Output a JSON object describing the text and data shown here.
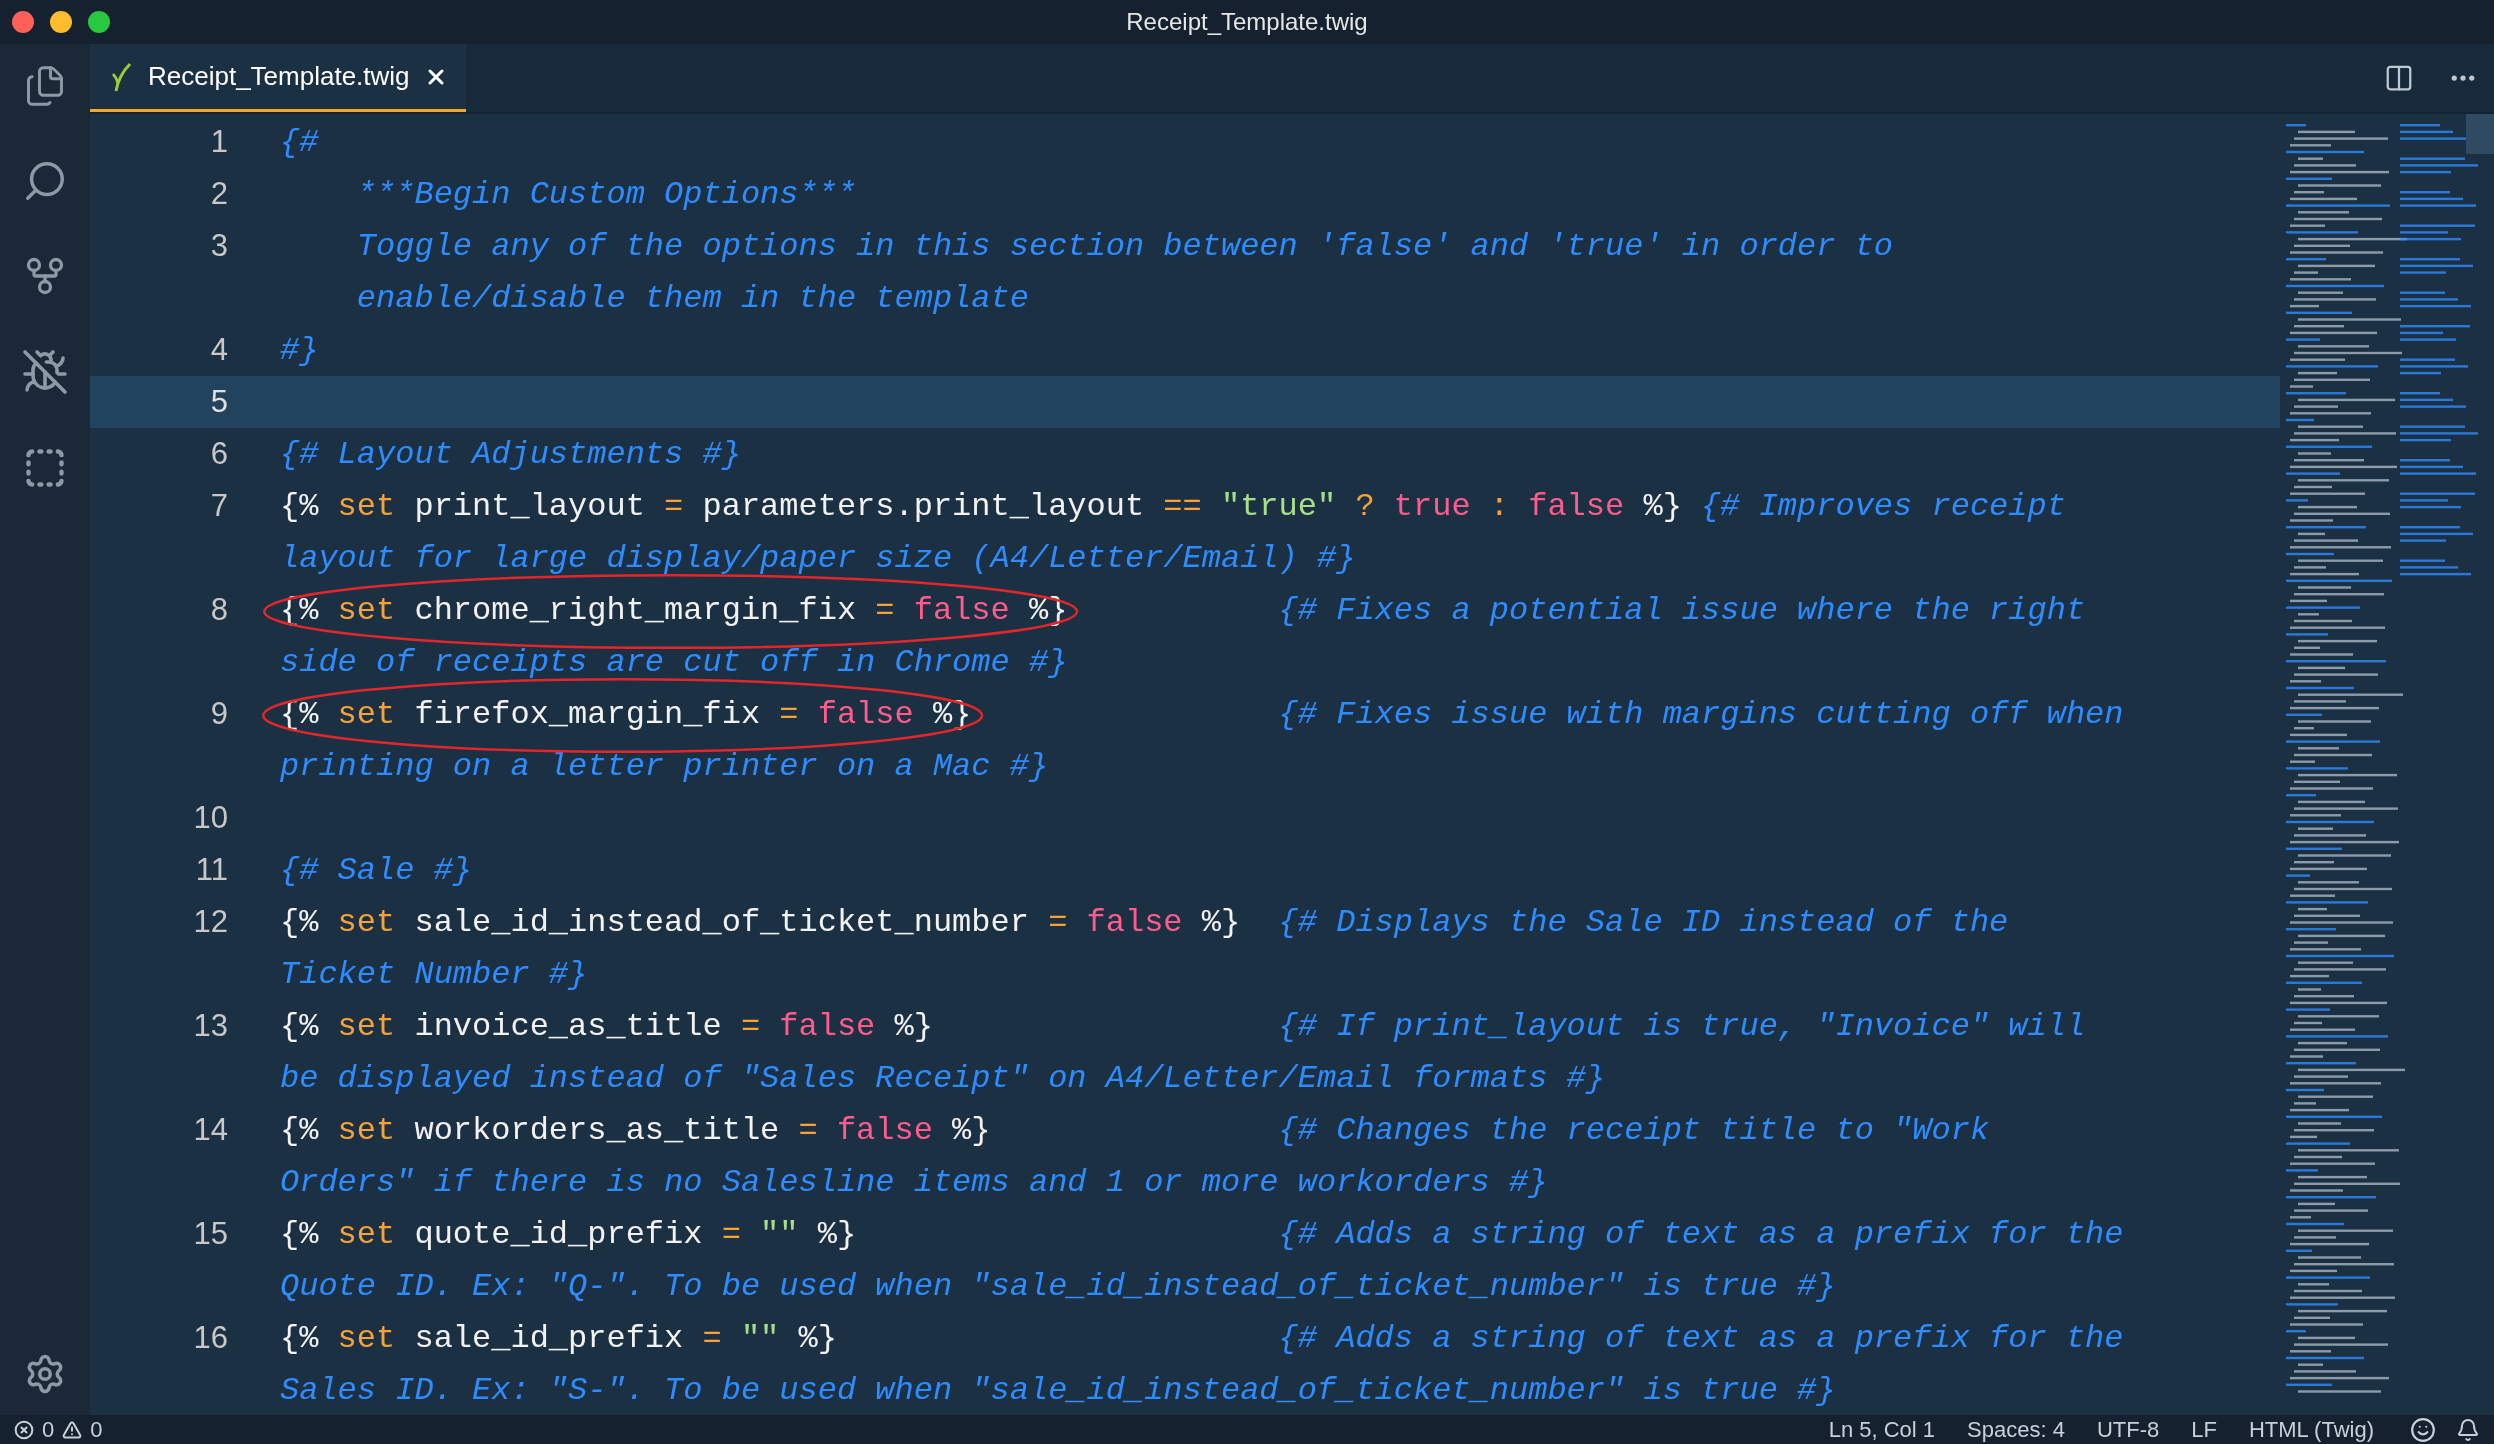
{
  "window": {
    "title": "Receipt_Template.twig"
  },
  "tabs": [
    {
      "label": "Receipt_Template.twig",
      "selected": true
    }
  ],
  "editor": {
    "lines": [
      {
        "number": "1",
        "current": false,
        "circled": false,
        "rows": [
          [
            {
              "text": "{#",
              "kind": "comment"
            }
          ]
        ]
      },
      {
        "number": "2",
        "current": false,
        "circled": false,
        "rows": [
          [
            {
              "text": "    ",
              "kind": "space"
            },
            {
              "text": "***Begin Custom Options***",
              "kind": "comment"
            }
          ]
        ]
      },
      {
        "number": "3",
        "current": false,
        "circled": false,
        "rows": [
          [
            {
              "text": "    ",
              "kind": "space"
            },
            {
              "text": "Toggle any of the options in this section between 'false' and 'true' in order to",
              "kind": "comment"
            }
          ],
          [
            {
              "text": "    ",
              "kind": "space"
            },
            {
              "text": "enable/disable them in the template",
              "kind": "comment"
            }
          ]
        ]
      },
      {
        "number": "4",
        "current": false,
        "circled": false,
        "rows": [
          [
            {
              "text": "#}",
              "kind": "comment"
            }
          ]
        ]
      },
      {
        "number": "5",
        "current": true,
        "circled": false,
        "rows": [
          []
        ]
      },
      {
        "number": "6",
        "current": false,
        "circled": false,
        "rows": [
          [
            {
              "text": "{# Layout Adjustments #}",
              "kind": "comment"
            }
          ]
        ]
      },
      {
        "number": "7",
        "current": false,
        "circled": false,
        "rows": [
          [
            {
              "text": "{% ",
              "kind": "punct"
            },
            {
              "text": "set",
              "kind": "keyword"
            },
            {
              "text": " print_layout ",
              "kind": "ident"
            },
            {
              "text": "=",
              "kind": "op"
            },
            {
              "text": " parameters.print_layout ",
              "kind": "ident"
            },
            {
              "text": "==",
              "kind": "op"
            },
            {
              "text": " ",
              "kind": "space"
            },
            {
              "text": "\"true\"",
              "kind": "string"
            },
            {
              "text": " ",
              "kind": "space"
            },
            {
              "text": "?",
              "kind": "op"
            },
            {
              "text": " ",
              "kind": "space"
            },
            {
              "text": "true",
              "kind": "bool"
            },
            {
              "text": " ",
              "kind": "space"
            },
            {
              "text": ":",
              "kind": "op"
            },
            {
              "text": " ",
              "kind": "space"
            },
            {
              "text": "false",
              "kind": "bool"
            },
            {
              "text": " %}",
              "kind": "punct"
            },
            {
              "text": " ",
              "kind": "space"
            },
            {
              "text": "{# Improves receipt",
              "kind": "comment"
            }
          ],
          [
            {
              "text": "layout for large display/paper size (A4/Letter/Email) #}",
              "kind": "comment"
            }
          ]
        ]
      },
      {
        "number": "8",
        "current": false,
        "circled": true,
        "rows": [
          [
            {
              "text": "{% ",
              "kind": "punct"
            },
            {
              "text": "set",
              "kind": "keyword"
            },
            {
              "text": " chrome_right_margin_fix ",
              "kind": "ident"
            },
            {
              "text": "=",
              "kind": "op"
            },
            {
              "text": " ",
              "kind": "space"
            },
            {
              "text": "false",
              "kind": "bool"
            },
            {
              "text": " %}",
              "kind": "punct"
            },
            {
              "text": "           ",
              "kind": "space"
            },
            {
              "text": "{# Fixes a potential issue where the right",
              "kind": "comment"
            }
          ],
          [
            {
              "text": "side of receipts are cut off in Chrome #}",
              "kind": "comment"
            }
          ]
        ]
      },
      {
        "number": "9",
        "current": false,
        "circled": true,
        "rows": [
          [
            {
              "text": "{% ",
              "kind": "punct"
            },
            {
              "text": "set",
              "kind": "keyword"
            },
            {
              "text": " firefox_margin_fix ",
              "kind": "ident"
            },
            {
              "text": "=",
              "kind": "op"
            },
            {
              "text": " ",
              "kind": "space"
            },
            {
              "text": "false",
              "kind": "bool"
            },
            {
              "text": " %}",
              "kind": "punct"
            },
            {
              "text": "                ",
              "kind": "space"
            },
            {
              "text": "{# Fixes issue with margins cutting off when",
              "kind": "comment"
            }
          ],
          [
            {
              "text": "printing on a letter printer on a Mac #}",
              "kind": "comment"
            }
          ]
        ]
      },
      {
        "number": "10",
        "current": false,
        "circled": false,
        "rows": [
          []
        ]
      },
      {
        "number": "11",
        "current": false,
        "circled": false,
        "rows": [
          [
            {
              "text": "{# Sale #}",
              "kind": "comment"
            }
          ]
        ]
      },
      {
        "number": "12",
        "current": false,
        "circled": false,
        "rows": [
          [
            {
              "text": "{% ",
              "kind": "punct"
            },
            {
              "text": "set",
              "kind": "keyword"
            },
            {
              "text": " sale_id_instead_of_ticket_number ",
              "kind": "ident"
            },
            {
              "text": "=",
              "kind": "op"
            },
            {
              "text": " ",
              "kind": "space"
            },
            {
              "text": "false",
              "kind": "bool"
            },
            {
              "text": " %}",
              "kind": "punct"
            },
            {
              "text": "  ",
              "kind": "space"
            },
            {
              "text": "{# Displays the Sale ID instead of the",
              "kind": "comment"
            }
          ],
          [
            {
              "text": "Ticket Number #}",
              "kind": "comment"
            }
          ]
        ]
      },
      {
        "number": "13",
        "current": false,
        "circled": false,
        "rows": [
          [
            {
              "text": "{% ",
              "kind": "punct"
            },
            {
              "text": "set",
              "kind": "keyword"
            },
            {
              "text": " invoice_as_title ",
              "kind": "ident"
            },
            {
              "text": "=",
              "kind": "op"
            },
            {
              "text": " ",
              "kind": "space"
            },
            {
              "text": "false",
              "kind": "bool"
            },
            {
              "text": " %}",
              "kind": "punct"
            },
            {
              "text": "                  ",
              "kind": "space"
            },
            {
              "text": "{# If print_layout is true, \"Invoice\" will",
              "kind": "comment"
            }
          ],
          [
            {
              "text": "be displayed instead of \"Sales Receipt\" on A4/Letter/Email formats #}",
              "kind": "comment"
            }
          ]
        ]
      },
      {
        "number": "14",
        "current": false,
        "circled": false,
        "rows": [
          [
            {
              "text": "{% ",
              "kind": "punct"
            },
            {
              "text": "set",
              "kind": "keyword"
            },
            {
              "text": " workorders_as_title ",
              "kind": "ident"
            },
            {
              "text": "=",
              "kind": "op"
            },
            {
              "text": " ",
              "kind": "space"
            },
            {
              "text": "false",
              "kind": "bool"
            },
            {
              "text": " %}",
              "kind": "punct"
            },
            {
              "text": "               ",
              "kind": "space"
            },
            {
              "text": "{# Changes the receipt title to \"Work",
              "kind": "comment"
            }
          ],
          [
            {
              "text": "Orders\" if there is no Salesline items and 1 or more workorders #}",
              "kind": "comment"
            }
          ]
        ]
      },
      {
        "number": "15",
        "current": false,
        "circled": false,
        "rows": [
          [
            {
              "text": "{% ",
              "kind": "punct"
            },
            {
              "text": "set",
              "kind": "keyword"
            },
            {
              "text": " quote_id_prefix ",
              "kind": "ident"
            },
            {
              "text": "=",
              "kind": "op"
            },
            {
              "text": " ",
              "kind": "space"
            },
            {
              "text": "\"\"",
              "kind": "string"
            },
            {
              "text": " %}",
              "kind": "punct"
            },
            {
              "text": "                      ",
              "kind": "space"
            },
            {
              "text": "{# Adds a string of text as a prefix for the",
              "kind": "comment"
            }
          ],
          [
            {
              "text": "Quote ID. Ex: \"Q-\". To be used when \"sale_id_instead_of_ticket_number\" is true #}",
              "kind": "comment"
            }
          ]
        ]
      },
      {
        "number": "16",
        "current": false,
        "circled": false,
        "rows": [
          [
            {
              "text": "{% ",
              "kind": "punct"
            },
            {
              "text": "set",
              "kind": "keyword"
            },
            {
              "text": " sale_id_prefix ",
              "kind": "ident"
            },
            {
              "text": "=",
              "kind": "op"
            },
            {
              "text": " ",
              "kind": "space"
            },
            {
              "text": "\"\"",
              "kind": "string"
            },
            {
              "text": " %}",
              "kind": "punct"
            },
            {
              "text": "                       ",
              "kind": "space"
            },
            {
              "text": "{# Adds a string of text as a prefix for the",
              "kind": "comment"
            }
          ],
          [
            {
              "text": "Sales ID. Ex: \"S-\". To be used when \"sale_id_instead_of_ticket_number\" is true #}",
              "kind": "comment"
            }
          ]
        ]
      }
    ]
  },
  "status_bar": {
    "errors": "0",
    "warnings": "0",
    "items": [
      "Ln 5, Col 1",
      "Spaces: 4",
      "UTF-8",
      "LF",
      "HTML (Twig)"
    ]
  }
}
